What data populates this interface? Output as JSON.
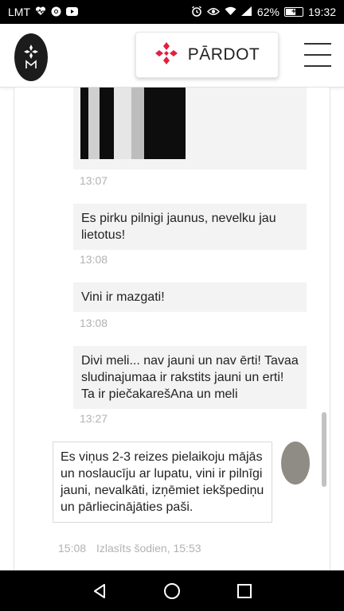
{
  "status_bar": {
    "carrier": "LMT",
    "left_icons": [
      "heart-rate-icon",
      "chrome-icon",
      "youtube-icon"
    ],
    "right_icons": [
      "alarm-icon",
      "eye-icon",
      "wifi-icon",
      "signal-icon"
    ],
    "battery": "62%",
    "battery_level": 0.62,
    "time": "19:32"
  },
  "header": {
    "sell_label": "PĀRDOT",
    "accent_color": "#e0213f"
  },
  "chat": {
    "messages": [
      {
        "time": "13:07"
      },
      {
        "text": "Es pirku pilnigi jaunus, nevelku jau lietotus!",
        "time": "13:08"
      },
      {
        "text": "Vini ir mazgati!",
        "time": "13:08"
      },
      {
        "text": "Divi meli... nav jauni un nav ērti! Tavaa sludinajumaa ir rakstits jauni un erti! Ta ir piečakarešAna un meli",
        "time": "13:27"
      }
    ],
    "outgoing": {
      "text": "Es viņus 2-3 reizes pielaikoju mājās un noslaucīju ar lupatu, vini ir pilnīgi jauni, nevalkāti, izņēmiet iekšpediņu un pārliecinājāties paši.",
      "time": "15:08",
      "read_status": "Izlasīts šodien, 15:53"
    }
  },
  "nav": {
    "icons": [
      "back-icon",
      "home-icon",
      "recents-icon"
    ]
  }
}
